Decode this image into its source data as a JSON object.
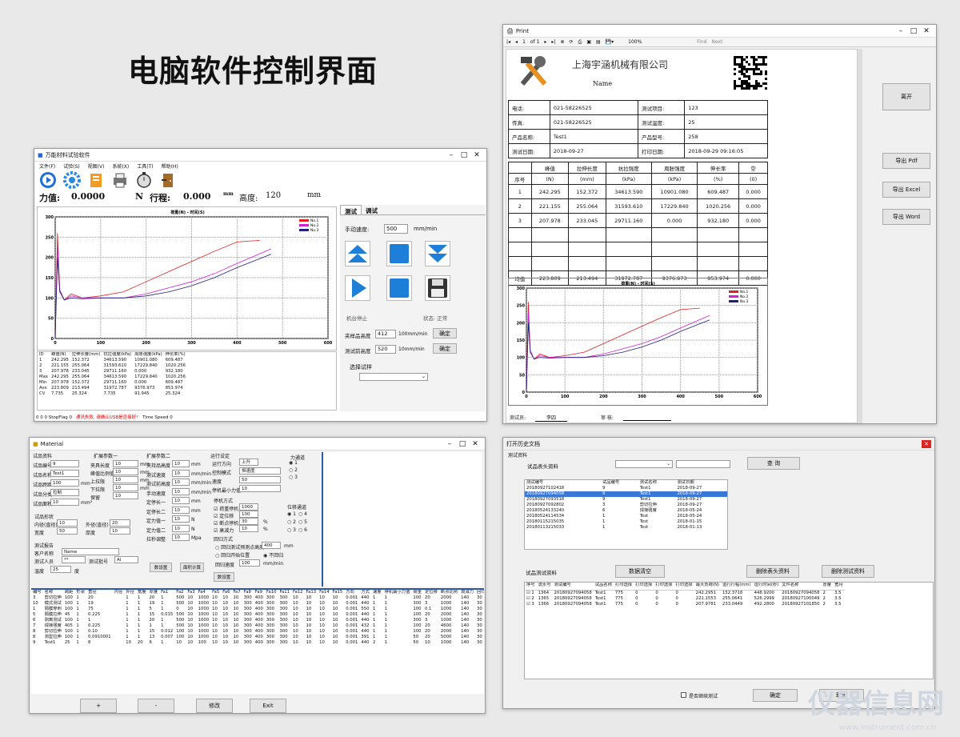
{
  "heading": "电脑软件控制界面",
  "win1": {
    "title": "万能材料试验软件",
    "menu": [
      "文件(F)",
      "试验(S)",
      "视图(V)",
      "系统(X)",
      "工具(T)",
      "帮助(H)"
    ],
    "force_label": "力值:",
    "force_value": "0.0000",
    "force_unit": "N",
    "stroke_label": "行程:",
    "stroke_value": "0.000",
    "stroke_unit": "mm",
    "height_label": "高度:",
    "height_value": "120",
    "height_unit": "mm",
    "tabs": [
      "测试",
      "调试"
    ],
    "speed_label": "手动速度:",
    "speed_value": "500",
    "speed_unit": "mm/min",
    "machine_status": "机台停止",
    "state_label": "状态: 正常",
    "clamp_label": "夹样品高度",
    "clamp_value": "412",
    "clamp_unit": "100mm/min",
    "confirm1": "确定",
    "test_label": "测试前高度",
    "test_value": "520",
    "test_unit": "10mm/min",
    "confirm2": "确定",
    "select_label": "选择试样",
    "status": "0  0  0  StopFlag  0",
    "status_red": "通讯失败, 请确认USB是否接好!",
    "status2": "Time  Speed  0",
    "table_header": [
      "ID",
      "峰值(N)",
      "拉伸长度(mm)",
      "抗拉强度(kPa)",
      "周胀强度(kPa)",
      "伸长率(%)"
    ],
    "table_rows": [
      [
        "1",
        "242.295",
        "152.372",
        "34613.590",
        "10901.080",
        "609.487"
      ],
      [
        "2",
        "221.155",
        "255.064",
        "31593.610",
        "17229.840",
        "1020.256"
      ],
      [
        "3",
        "207.978",
        "233.045",
        "29711.160",
        "0.000",
        "932.180"
      ],
      [
        "Max",
        "242.295",
        "255.064",
        "34613.590",
        "17229.840",
        "1020.256"
      ],
      [
        "Min",
        "207.978",
        "152.372",
        "29711.160",
        "0.000",
        "609.487"
      ],
      [
        "Ave",
        "223.809",
        "213.494",
        "31972.787",
        "9376.973",
        "853.974"
      ],
      [
        "CV",
        "7.735",
        "25.324",
        "7.735",
        "91.945",
        "25.324"
      ]
    ]
  },
  "chart_data": [
    {
      "type": "line",
      "title": "荷重(N) - 时间(S)",
      "xlim": [
        0,
        600
      ],
      "ylim": [
        0,
        300
      ],
      "x_ticks": [
        0,
        100,
        200,
        300,
        400,
        500,
        600
      ],
      "y_ticks": [
        0,
        50,
        100,
        150,
        200,
        250,
        300
      ],
      "legend": "top-right",
      "grid": true,
      "series": [
        {
          "name": "No.1",
          "color": "#e02020",
          "x": [
            0,
            5,
            10,
            20,
            35,
            60,
            100,
            150,
            200,
            250,
            300,
            350,
            400,
            450
          ],
          "y": [
            0,
            260,
            120,
            95,
            110,
            100,
            105,
            115,
            140,
            165,
            190,
            215,
            238,
            242
          ]
        },
        {
          "name": "No.2",
          "color": "#d020d0",
          "x": [
            0,
            5,
            10,
            20,
            35,
            60,
            100,
            150,
            200,
            250,
            300,
            350,
            400,
            475
          ],
          "y": [
            0,
            230,
            120,
            95,
            105,
            100,
            100,
            100,
            110,
            125,
            140,
            160,
            185,
            221
          ]
        },
        {
          "name": "No.3",
          "color": "#202080",
          "x": [
            0,
            5,
            10,
            20,
            35,
            60,
            100,
            150,
            200,
            250,
            300,
            350,
            400,
            475
          ],
          "y": [
            0,
            200,
            115,
            95,
            100,
            98,
            100,
            100,
            105,
            115,
            130,
            150,
            175,
            208
          ]
        }
      ]
    },
    {
      "type": "line",
      "title": "荷重(N) - 时间(S)",
      "xlim": [
        0,
        600
      ],
      "ylim": [
        0,
        300
      ],
      "legend": "top-right",
      "grid": true,
      "series": [
        {
          "name": "No.1",
          "color": "#e02020"
        },
        {
          "name": "No.2",
          "color": "#d020d0"
        },
        {
          "name": "No.3",
          "color": "#202080"
        }
      ]
    }
  ],
  "print": {
    "title": "Print",
    "page": "1",
    "of": "of 1",
    "zoom": "100%",
    "find": "Find",
    "next": "Next",
    "company": "上海宇涵机械有限公司",
    "name": "Name",
    "info": [
      [
        "电话:",
        "021-58226525",
        "测试项目:",
        "123"
      ],
      [
        "传真:",
        "021-58226525",
        "测试温度:",
        "25"
      ],
      [
        "产品名称:",
        "Test1",
        "产品型号:",
        "258"
      ],
      [
        "测试日期:",
        "2018-09-27",
        "打印日期:",
        "2018-09-29 09:16:05"
      ]
    ],
    "col_head": [
      "",
      "峰值",
      "拉伸长度",
      "抗拉强度",
      "周胀强度",
      "伸长率",
      "空"
    ],
    "col_units": [
      "序号",
      "(N)",
      "(mm)",
      "(kPa)",
      "(kPa)",
      "(%)",
      "(0)"
    ],
    "rows": [
      [
        "1",
        "242.295",
        "152.372",
        "34613.590",
        "10901.080",
        "609.487",
        "0.000"
      ],
      [
        "2",
        "221.155",
        "255.064",
        "31593.610",
        "17229.840",
        "1020.256",
        "0.000"
      ],
      [
        "3",
        "207.978",
        "233.045",
        "29711.160",
        "0.000",
        "932.180",
        "0.000"
      ]
    ],
    "avg": [
      "均值",
      "223.809",
      "213.494",
      "31972.787",
      "9376.973",
      "853.974",
      "0.000"
    ],
    "tester_label": "测试员:",
    "tester": "李四",
    "reviewer_label": "审  核:",
    "buttons": [
      "离开",
      "导出 Pdf",
      "导出 Excel",
      "导出 Word"
    ]
  },
  "material": {
    "title": "Material",
    "group1": "试品资料",
    "ext1": "扩展参数一",
    "ext2": "扩展参数二",
    "run": "运行设定",
    "g1_fields": [
      [
        "试品编号",
        "9"
      ],
      [
        "试品名称",
        "Test1"
      ],
      [
        "试品跨距",
        "100"
      ],
      [
        "试品分类",
        "拉制"
      ],
      [
        "试品面积",
        "10"
      ]
    ],
    "e1_fields": [
      [
        "夹具长度",
        "10"
      ],
      [
        "峰值比例值",
        "10"
      ],
      [
        "上拉限",
        "10"
      ],
      [
        "下拉限",
        "10"
      ],
      [
        "保留",
        "10"
      ]
    ],
    "e2_fields": [
      [
        "夹持品高度",
        "10"
      ],
      [
        "测试速度",
        "10"
      ],
      [
        "测试前高度",
        "10"
      ],
      [
        "手动速度",
        "10"
      ],
      [
        "定停长一",
        "10"
      ],
      [
        "定停长二",
        "10"
      ],
      [
        "定力值一",
        "10"
      ],
      [
        "定力值二",
        "10"
      ],
      [
        "拉秒调整",
        "10"
      ]
    ],
    "units": [
      "mm",
      "mm/min",
      "mm/min",
      "mm/min",
      "mm",
      "mm",
      "N",
      "N",
      "Mpa"
    ],
    "run_fields": [
      [
        "运行方向",
        "上升"
      ],
      [
        "控制模式",
        "恒速度"
      ],
      [
        "速度",
        "50"
      ],
      [
        "停机最小力值",
        "10"
      ]
    ],
    "stop_label": "停机方式",
    "stops": [
      [
        "荷重停机",
        "1000"
      ],
      [
        "定位移",
        "100"
      ],
      [
        "断点停机",
        "30"
      ],
      [
        "衰减力",
        "10"
      ]
    ],
    "stop_units": [
      "",
      "",
      "%",
      "%"
    ],
    "return_label": "回归方式",
    "return1": "回归测试预测点高度",
    "return1_val": "400",
    "return2": "回归开始位置",
    "return3": "不回归",
    "return_speed": "回归速度",
    "return_speed_val": "100",
    "return_speed_unit": "mm/min",
    "channel": "力通道",
    "channel_opts": [
      "1",
      "2",
      "3"
    ],
    "disp": "位移通道",
    "disp_opts": [
      "1",
      "4",
      "2",
      "5",
      "3",
      "6"
    ],
    "spec_label": "试品形状",
    "spec_fields": [
      [
        "内径(直径)",
        "10"
      ],
      [
        "宽度",
        "50"
      ]
    ],
    "spec2": [
      [
        "外径(直径)",
        "20"
      ],
      [
        "厚度",
        "10"
      ]
    ],
    "tester_group": "测试报告",
    "customer": "客户名称",
    "customer_val": "Name",
    "tester": "测试人员",
    "tester_val": "**",
    "testno": "测试批号",
    "testno_val": "AI",
    "temp": "温度",
    "temp_val": "25",
    "temp_unit": "度",
    "save_btn": "数设置",
    "calc_btn": "面积计算",
    "save2": "数设置",
    "list_header": [
      "编号",
      "名称",
      "跨距",
      "形状",
      "直径",
      "内径",
      "外径",
      "宽度",
      "厚度",
      "Fa1",
      "Fa2",
      "Fa3",
      "Fa4",
      "Fa5",
      "Fa6",
      "Fa7",
      "Fa8",
      "Fa9",
      "Fa10",
      "Fa11",
      "Fa12",
      "Fa13",
      "Fa14",
      "Fa15",
      "方向",
      "方式",
      "速度",
      "停机最小力值",
      "荷重",
      "定位移",
      "断点比例",
      "衰减力",
      "回归方"
    ],
    "list_rows": [
      [
        "3",
        "剪切拉伸",
        "100",
        "1",
        "20",
        "",
        "1",
        "1",
        "20",
        "1",
        "500",
        "10",
        "1000",
        "10",
        "10",
        "10",
        "300",
        "400",
        "300",
        "300",
        "10",
        "10",
        "10",
        "10",
        "0.001",
        "440",
        "1",
        "1",
        "100",
        "20",
        "2000",
        "140",
        "30"
      ],
      [
        "10",
        "模式测试",
        "100",
        "1",
        "19",
        "",
        "1",
        "1",
        "19",
        "1",
        "500",
        "10",
        "1000",
        "10",
        "10",
        "10",
        "300",
        "400",
        "300",
        "300",
        "10",
        "10",
        "10",
        "10",
        "0.001",
        "440",
        "1",
        "1",
        "300",
        "3",
        "1000",
        "140",
        "30"
      ],
      [
        "1",
        "隔膜穿刺",
        "100",
        "1",
        "75",
        "",
        "1",
        "1",
        "5",
        "1",
        "0",
        "10",
        "1000",
        "10",
        "10",
        "10",
        "300",
        "400",
        "300",
        "300",
        "10",
        "10",
        "10",
        "10",
        "0.001",
        "550",
        "1",
        "1",
        "100",
        "0.1",
        "1000",
        "140",
        "30"
      ],
      [
        "5",
        "隔膜拉伸",
        "45",
        "1",
        "0.225",
        "",
        "1",
        "1",
        "15",
        "0.015",
        "500",
        "10",
        "1000",
        "10",
        "10",
        "10",
        "300",
        "400",
        "300",
        "300",
        "10",
        "10",
        "10",
        "10",
        "0.001",
        "440",
        "1",
        "1",
        "100",
        "20",
        "2000",
        "140",
        "30"
      ],
      [
        "6",
        "剥离测试",
        "100",
        "1",
        "1",
        "",
        "1",
        "1",
        "20",
        "1",
        "500",
        "10",
        "1000",
        "10",
        "10",
        "10",
        "300",
        "400",
        "300",
        "300",
        "10",
        "10",
        "10",
        "10",
        "0.001",
        "440",
        "1",
        "1",
        "300",
        "3",
        "1000",
        "140",
        "30"
      ],
      [
        "7",
        "焊接强度",
        "405",
        "1",
        "0.225",
        "",
        "1",
        "1",
        "1",
        "1",
        "500",
        "10",
        "1000",
        "10",
        "10",
        "10",
        "300",
        "400",
        "300",
        "300",
        "10",
        "10",
        "10",
        "10",
        "0.001",
        "432",
        "1",
        "1",
        "100",
        "20",
        "4600",
        "140",
        "30"
      ],
      [
        "8",
        "剪切拉伸",
        "100",
        "1",
        "0.10",
        "",
        "1",
        "1",
        "15",
        "0.012",
        "100",
        "10",
        "1000",
        "10",
        "10",
        "10",
        "300",
        "400",
        "300",
        "300",
        "10",
        "10",
        "10",
        "10",
        "0.001",
        "440",
        "1",
        "1",
        "100",
        "20",
        "2000",
        "140",
        "30"
      ],
      [
        "8",
        "测型拉伸",
        "100",
        "1",
        "0.0910001",
        "",
        "1",
        "1",
        "13",
        "0.007",
        "100",
        "10",
        "1000",
        "10",
        "10",
        "10",
        "300",
        "400",
        "300",
        "300",
        "10",
        "10",
        "10",
        "10",
        "0.001",
        "391",
        "1",
        "1",
        "50",
        "20",
        "5000",
        "140",
        "30"
      ],
      [
        "9",
        "Test1",
        "25",
        "1",
        "8",
        "",
        "10",
        "20",
        "6",
        "1",
        "10",
        "10",
        "100",
        "10",
        "10",
        "10",
        "300",
        "400",
        "300",
        "300",
        "10",
        "10",
        "10",
        "10",
        "0.001",
        "440",
        "2",
        "1",
        "50",
        "10",
        "1000",
        "140",
        "30"
      ]
    ],
    "bottom_buttons": [
      "+",
      "-",
      "修改",
      "Exit"
    ]
  },
  "history": {
    "title": "打开历史文档",
    "section": "测试资料",
    "header_label": "试品表头资料",
    "query": "查 询",
    "list_head": [
      "测试编号",
      "试品编号",
      "测试名称",
      "测试日期"
    ],
    "list_rows": [
      [
        "20180927102418",
        "9",
        "Test1",
        "2018-09-27"
      ],
      [
        "20180927094058",
        "9",
        "Test1",
        "2018-09-27"
      ],
      [
        "20180927093518",
        "9",
        "Test1",
        "2018-09-27"
      ],
      [
        "20180927092802",
        "3",
        "剪切拉伸",
        "2018-09-27"
      ],
      [
        "20180524133240",
        "6",
        "焊接强度",
        "2018-05-24"
      ],
      [
        "20180524114534",
        "1",
        "Test",
        "2018-05-24"
      ],
      [
        "20180115215035",
        "1",
        "Test",
        "2018-01-15"
      ],
      [
        "20180113215033",
        "1",
        "Test",
        "2018-01-13"
      ]
    ],
    "selected": 1,
    "section2": "试品测试资料",
    "clear": "数据清空",
    "del_head": "删除表头资料",
    "del_test": "删除测试资料",
    "t_head": [
      "序号",
      "流水号",
      "测试编号",
      "试品名称",
      "打印选择",
      "打印选择",
      "打印选择",
      "打印选择",
      "最大负荷(N)",
      "运行行程(mm)",
      "运行时间(秒)",
      "文件名称",
      "厚度",
      "宽月"
    ],
    "t_rows": [
      [
        "1",
        "1364",
        "20180927094058",
        "Test1",
        "775",
        "0",
        "0",
        "0",
        "242.2951",
        "152.3718",
        "448.9200",
        "20180927094058",
        "2",
        "3.5"
      ],
      [
        "2",
        "1365",
        "20180927094058",
        "Test1",
        "775",
        "0",
        "0",
        "0",
        "221.1553",
        "255.0641",
        "526.2999",
        "20180927100049",
        "2",
        "3.5"
      ],
      [
        "3",
        "1366",
        "20180927094058",
        "Test1",
        "775",
        "0",
        "0",
        "0",
        "207.9781",
        "233.0449",
        "492.2800",
        "20180927101850",
        "2",
        "3.5"
      ]
    ],
    "continue_label": "是否继续测试",
    "ok": "确定",
    "cancel": "取消"
  },
  "watermark": "仪器信息网",
  "watermark_url": "www.instrument.com.cn"
}
